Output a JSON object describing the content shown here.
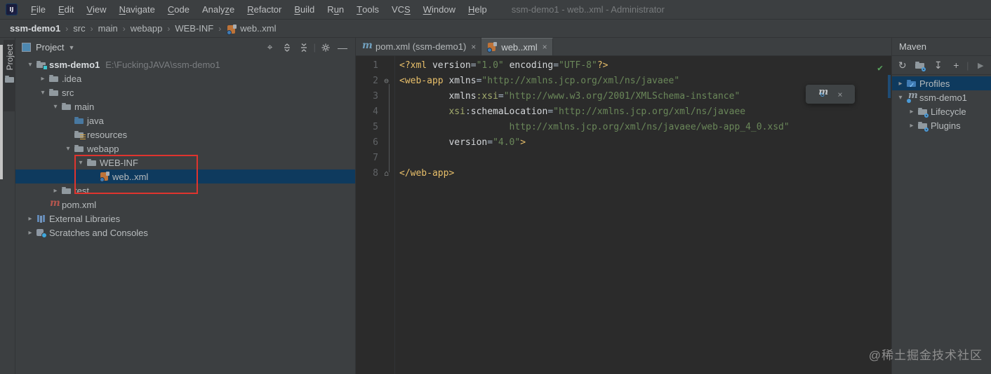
{
  "window": {
    "title": "ssm-demo1 - web..xml - Administrator"
  },
  "menubar": {
    "items": [
      {
        "pre": "",
        "u": "F",
        "post": "ile"
      },
      {
        "pre": "",
        "u": "E",
        "post": "dit"
      },
      {
        "pre": "",
        "u": "V",
        "post": "iew"
      },
      {
        "pre": "",
        "u": "N",
        "post": "avigate"
      },
      {
        "pre": "",
        "u": "C",
        "post": "ode"
      },
      {
        "pre": "Analy",
        "u": "z",
        "post": "e"
      },
      {
        "pre": "",
        "u": "R",
        "post": "efactor"
      },
      {
        "pre": "",
        "u": "B",
        "post": "uild"
      },
      {
        "pre": "R",
        "u": "u",
        "post": "n"
      },
      {
        "pre": "",
        "u": "T",
        "post": "ools"
      },
      {
        "pre": "VC",
        "u": "S",
        "post": ""
      },
      {
        "pre": "",
        "u": "W",
        "post": "indow"
      },
      {
        "pre": "",
        "u": "H",
        "post": "elp"
      }
    ]
  },
  "breadcrumbs": {
    "items": [
      "ssm-demo1",
      "src",
      "main",
      "webapp",
      "WEB-INF",
      "web..xml"
    ],
    "last_icon": "webxml"
  },
  "tool_stripe": {
    "tab_label": "Project"
  },
  "project_panel": {
    "title": "Project",
    "toolbar_icons": [
      "locate",
      "expand-all",
      "collapse-all",
      "settings",
      "hide"
    ],
    "tree": [
      {
        "label": "ssm-demo1",
        "secondary": "E:\\FuckingJAVA\\ssm-demo1",
        "depth": 0,
        "chevron": "v",
        "icon": "folder-root",
        "bold": true
      },
      {
        "label": ".idea",
        "depth": 1,
        "chevron": ">",
        "icon": "folder"
      },
      {
        "label": "src",
        "depth": 1,
        "chevron": "v",
        "icon": "folder"
      },
      {
        "label": "main",
        "depth": 2,
        "chevron": "v",
        "icon": "folder"
      },
      {
        "label": "java",
        "depth": 3,
        "chevron": "",
        "icon": "folder-java"
      },
      {
        "label": "resources",
        "depth": 3,
        "chevron": "",
        "icon": "folder-res"
      },
      {
        "label": "webapp",
        "depth": 3,
        "chevron": "v",
        "icon": "folder"
      },
      {
        "label": "WEB-INF",
        "depth": 4,
        "chevron": "v",
        "icon": "folder"
      },
      {
        "label": "web..xml",
        "depth": 5,
        "chevron": "",
        "icon": "webxml",
        "selected": true
      },
      {
        "label": "test",
        "depth": 2,
        "chevron": ">",
        "icon": "folder"
      },
      {
        "label": "pom.xml",
        "depth": 1,
        "chevron": "",
        "icon": "maven-red"
      },
      {
        "label": "External Libraries",
        "depth": 0,
        "chevron": ">",
        "icon": "lib"
      },
      {
        "label": "Scratches and Consoles",
        "depth": 0,
        "chevron": ">",
        "icon": "scratch"
      }
    ]
  },
  "editor": {
    "tabs": [
      {
        "label": "pom.xml (ssm-demo1)",
        "icon": "maven-tab",
        "close": "×",
        "active": false
      },
      {
        "label": "web..xml",
        "icon": "webxml",
        "close": "×",
        "active": true
      }
    ],
    "inspection_status": "✔",
    "float_widget": {
      "icons": [
        "maven-reload-icon",
        "close-icon"
      ],
      "close": "×",
      "sync_glyph": "↻",
      "m_glyph": "m"
    },
    "lines": [
      {
        "num": "1",
        "fold": "",
        "tokens": [
          [
            "tag",
            "<?xml "
          ],
          [
            "attr",
            "version"
          ],
          [
            "pl",
            "="
          ],
          [
            "str",
            "\"1.0\""
          ],
          [
            "pl",
            " "
          ],
          [
            "attr",
            "encoding"
          ],
          [
            "pl",
            "="
          ],
          [
            "str",
            "\"UTF-8\""
          ],
          [
            "tag",
            "?>"
          ]
        ]
      },
      {
        "num": "2",
        "fold": "start",
        "tokens": [
          [
            "tag",
            "<web-app "
          ],
          [
            "attr",
            "xmlns"
          ],
          [
            "pl",
            "="
          ],
          [
            "str",
            "\"http://xmlns.jcp.org/xml/ns/javaee\""
          ]
        ]
      },
      {
        "num": "3",
        "fold": "",
        "tokens": [
          [
            "pl",
            "         "
          ],
          [
            "attr",
            "xmlns"
          ],
          [
            "ns",
            ":xsi"
          ],
          [
            "pl",
            "="
          ],
          [
            "str",
            "\"http://www.w3.org/2001/XMLSchema-instance\""
          ]
        ]
      },
      {
        "num": "4",
        "fold": "",
        "tokens": [
          [
            "pl",
            "         "
          ],
          [
            "ns",
            "xsi"
          ],
          [
            "pl",
            ":"
          ],
          [
            "attr",
            "schemaLocation"
          ],
          [
            "pl",
            "="
          ],
          [
            "str",
            "\"http://xmlns.jcp.org/xml/ns/javaee"
          ]
        ]
      },
      {
        "num": "5",
        "fold": "",
        "tokens": [
          [
            "pl",
            "                    "
          ],
          [
            "str",
            "http://xmlns.jcp.org/xml/ns/javaee/web-app_4_0.xsd\""
          ]
        ]
      },
      {
        "num": "6",
        "fold": "",
        "tokens": [
          [
            "pl",
            "         "
          ],
          [
            "attr",
            "version"
          ],
          [
            "pl",
            "="
          ],
          [
            "str",
            "\"4.0\""
          ],
          [
            "tag",
            ">"
          ]
        ]
      },
      {
        "num": "7",
        "fold": "",
        "tokens": []
      },
      {
        "num": "8",
        "fold": "end",
        "tokens": [
          [
            "tag",
            "</web-app>"
          ]
        ]
      }
    ],
    "fold_glyphs": {
      "start": "⊖",
      "end": "⌂"
    }
  },
  "maven_panel": {
    "title": "Maven",
    "toolbar_icons": [
      "reload-all",
      "run-configuration",
      "download-sources",
      "add",
      "execute-goal"
    ],
    "tree": [
      {
        "label": "Profiles",
        "depth": 0,
        "chevron": ">",
        "icon": "folder-check",
        "selected": true
      },
      {
        "label": "ssm-demo1",
        "depth": 0,
        "chevron": "v",
        "icon": "maven-module"
      },
      {
        "label": "Lifecycle",
        "depth": 1,
        "chevron": ">",
        "icon": "folder-gear"
      },
      {
        "label": "Plugins",
        "depth": 1,
        "chevron": ">",
        "icon": "folder-gear"
      }
    ]
  },
  "watermark": {
    "text": "@稀土掘金技术社区"
  },
  "colors": {
    "panel_bg": "#3c3f41",
    "editor_bg": "#2b2b2b",
    "selection": "#0e3a5e",
    "annotation_red": "#df342e",
    "tag": "#e8bf6a",
    "string": "#6a8759",
    "ok_green": "#57a05b",
    "accent_blue": "#4b9bd8"
  }
}
